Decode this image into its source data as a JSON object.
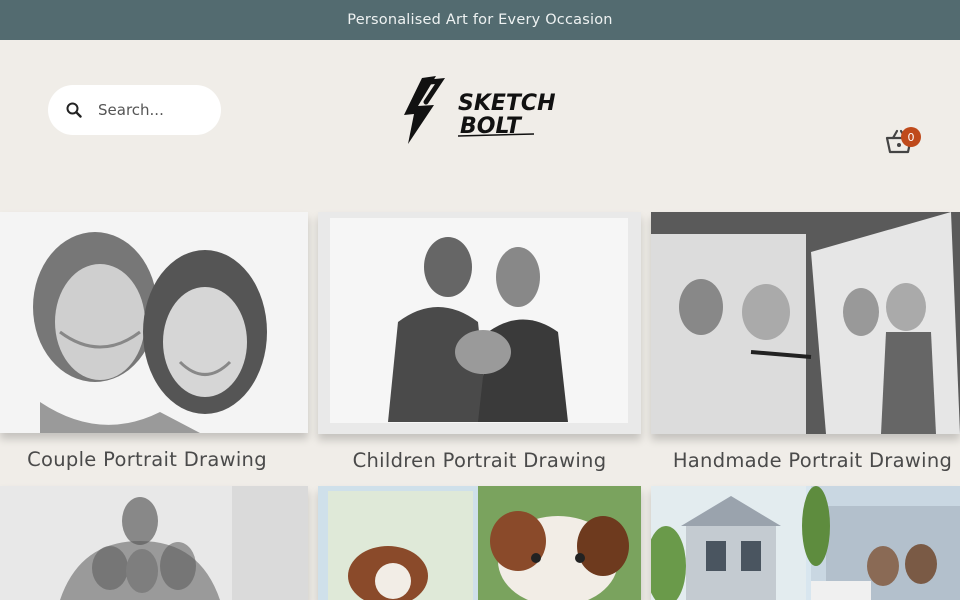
{
  "announcement": "Personalised Art for Every Occasion",
  "search": {
    "placeholder": "Search..."
  },
  "logo": {
    "line1": "SKETCH",
    "line2": "BOLT"
  },
  "cart": {
    "count": "0"
  },
  "products": [
    {
      "label": "Couple Portrait Drawing"
    },
    {
      "label": "Children Portrait Drawing"
    },
    {
      "label": "Handmade Portrait Drawing"
    },
    {
      "label": ""
    },
    {
      "label": ""
    },
    {
      "label": ""
    }
  ],
  "colors": {
    "announce_bg": "#536b70",
    "page_bg": "#f0ede8",
    "cart_badge": "#bf4a1b"
  }
}
